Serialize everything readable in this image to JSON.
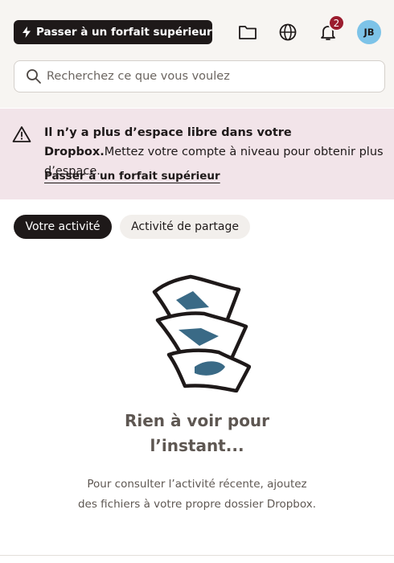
{
  "header": {
    "upgrade_label": "Passer à un forfait supérieur",
    "notification_count": "2",
    "avatar_initials": "JB",
    "icons": [
      "bolt-icon",
      "folder-icon",
      "globe-icon",
      "bell-icon"
    ]
  },
  "search": {
    "placeholder": "Recherchez ce que vous voulez"
  },
  "banner": {
    "bold_text": "Il n’y a plus d’espace libre dans votre Dropbox.",
    "text": "Mettez votre compte à niveau pour obtenir plus d’espace.",
    "link_label": "Passer à un forfait supérieur"
  },
  "tabs": [
    {
      "label": "Votre activité",
      "active": true
    },
    {
      "label": "Activité de partage",
      "active": false
    }
  ],
  "empty_state": {
    "title": "Rien à voir pour l’instant...",
    "description": "Pour consulter l’activité récente, ajoutez des fichiers à votre propre dossier Dropbox."
  },
  "colors": {
    "topbar_bg": "#f7f5f2",
    "banner_bg": "#f2e4e9",
    "dark": "#1e1919",
    "badge": "#9b1c2e",
    "avatar": "#7dc3e8",
    "illustration_accent": "#3a6a86"
  }
}
